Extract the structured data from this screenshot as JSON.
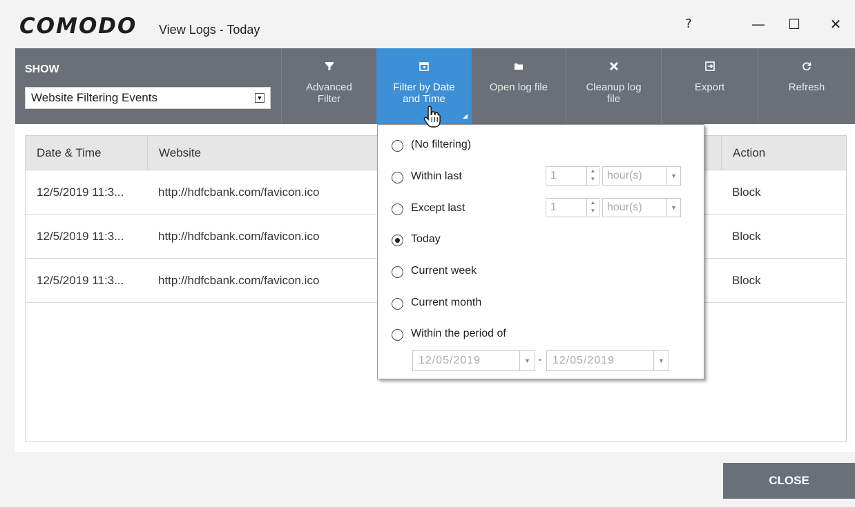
{
  "window": {
    "logo": "COMODO",
    "title": "View Logs - Today",
    "help": "?",
    "minimize": "—",
    "maximize": "☐",
    "close": "✕"
  },
  "toolbar": {
    "show_label": "SHOW",
    "show_value": "Website Filtering Events",
    "buttons": [
      {
        "label_line1": "Advanced",
        "label_line2": "Filter",
        "icon": "funnel-icon"
      },
      {
        "label_line1": "Filter by Date",
        "label_line2": "and Time",
        "icon": "calendar-icon",
        "active": true
      },
      {
        "label_line1": "Open log file",
        "label_line2": "",
        "icon": "folder-icon"
      },
      {
        "label_line1": "Cleanup log",
        "label_line2": "file",
        "icon": "x-icon"
      },
      {
        "label_line1": "Export",
        "label_line2": "",
        "icon": "export-icon"
      },
      {
        "label_line1": "Refresh",
        "label_line2": "",
        "icon": "refresh-icon"
      }
    ]
  },
  "table": {
    "columns": [
      "Date & Time",
      "Website",
      "Action"
    ],
    "rows": [
      {
        "datetime": "12/5/2019 11:3...",
        "website": "http://hdfcbank.com/favicon.ico",
        "action": "Block"
      },
      {
        "datetime": "12/5/2019 11:3...",
        "website": "http://hdfcbank.com/favicon.ico",
        "action": "Block"
      },
      {
        "datetime": "12/5/2019 11:3...",
        "website": "http://hdfcbank.com/favicon.ico",
        "action": "Block"
      }
    ]
  },
  "date_filter": {
    "options": [
      "(No filtering)",
      "Within last",
      "Except last",
      "Today",
      "Current week",
      "Current month",
      "Within the period of"
    ],
    "selected": "Today",
    "within_last_value": "1",
    "within_last_unit": "hour(s)",
    "except_last_value": "1",
    "except_last_unit": "hour(s)",
    "period_from": "12/05/2019",
    "period_to": "12/05/2019",
    "period_separator": "-"
  },
  "footer": {
    "close_label": "CLOSE"
  },
  "colors": {
    "toolbar_bg": "#6a6f78",
    "active_button": "#3d8fd6",
    "table_header": "#e6e6e6",
    "window_bg": "#f3f3f3"
  }
}
